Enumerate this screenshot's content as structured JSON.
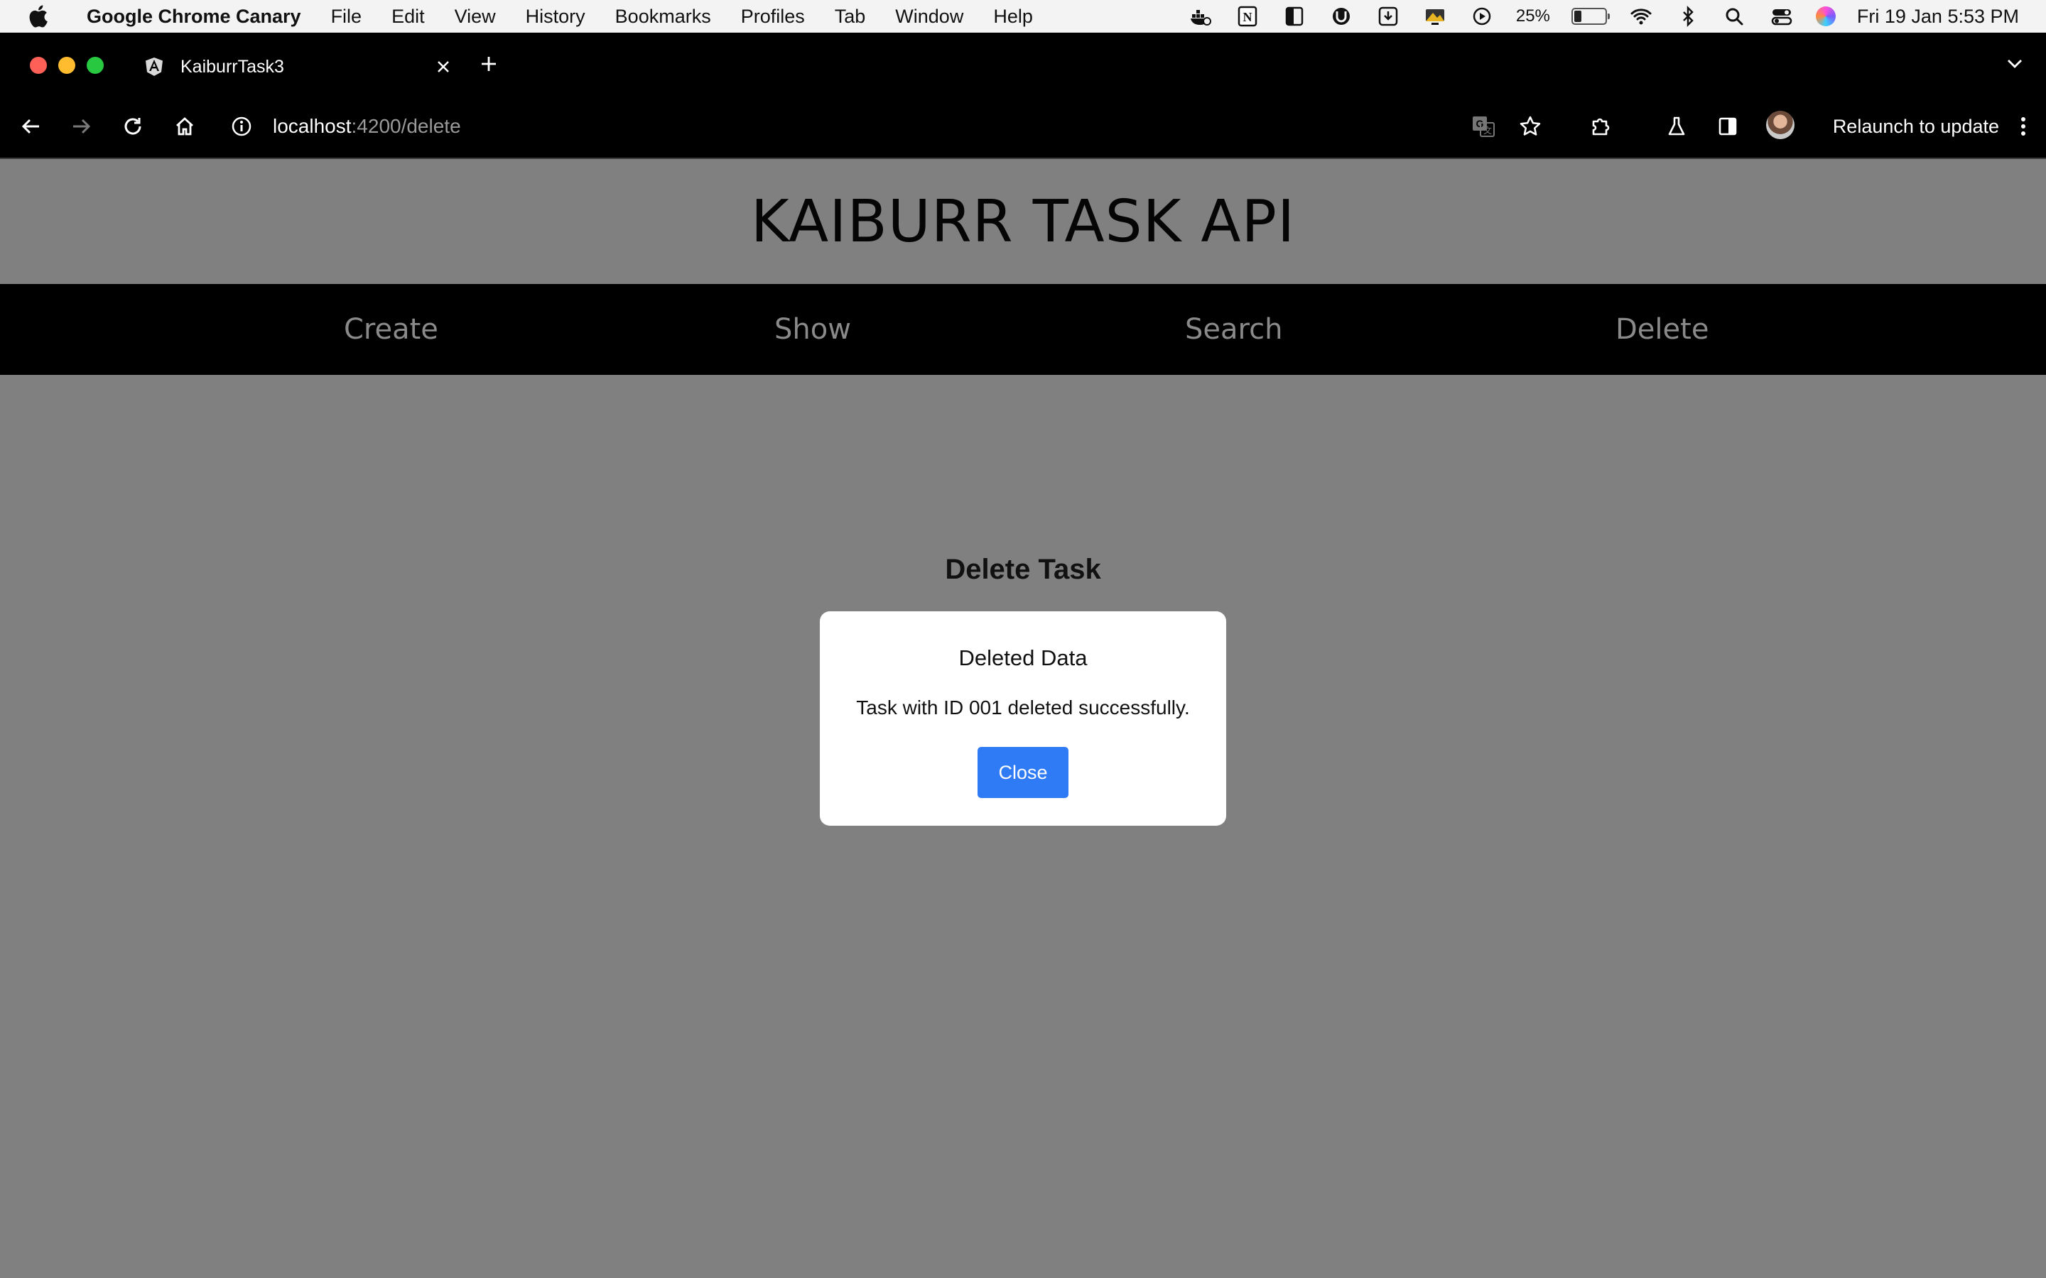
{
  "menubar": {
    "app_name": "Google Chrome Canary",
    "items": [
      "File",
      "Edit",
      "View",
      "History",
      "Bookmarks",
      "Profiles",
      "Tab",
      "Window",
      "Help"
    ],
    "battery_percent": "25%",
    "clock": "Fri 19 Jan  5:53 PM"
  },
  "browser": {
    "tab_title": "KaiburrTask3",
    "url_host": "localhost",
    "url_rest": ":4200/delete",
    "relaunch_label": "Relaunch to update"
  },
  "site": {
    "title": "KAIBURR TASK API",
    "nav": [
      "Create",
      "Show",
      "Search",
      "Delete"
    ]
  },
  "main": {
    "heading": "Delete Task"
  },
  "modal": {
    "title": "Deleted Data",
    "message": "Task with ID 001 deleted successfully.",
    "close_label": "Close"
  },
  "colors": {
    "page_background": "#808080",
    "navbar_background": "#000000",
    "nav_link": "#8a8a8a",
    "button_primary": "#2f7bf5"
  }
}
